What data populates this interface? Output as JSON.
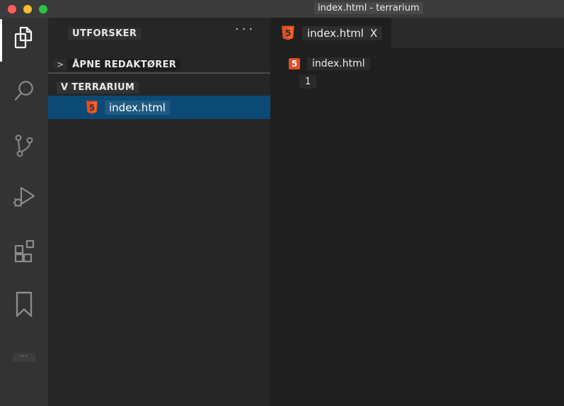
{
  "window": {
    "title": "index.html - terrarium"
  },
  "titlebar": {
    "traffic_lights": [
      {
        "name": "close",
        "color": "#ff5f57"
      },
      {
        "name": "minimize",
        "color": "#febc2e"
      },
      {
        "name": "zoom",
        "color": "#28c840"
      }
    ]
  },
  "activity_bar": {
    "items": [
      {
        "id": "explorer",
        "icon": "files-icon",
        "active": true
      },
      {
        "id": "search",
        "icon": "search-icon",
        "active": false
      },
      {
        "id": "source-control",
        "icon": "source-control-icon",
        "active": false
      },
      {
        "id": "run-debug",
        "icon": "run-debug-icon",
        "active": false
      },
      {
        "id": "extensions",
        "icon": "extensions-icon",
        "active": false
      },
      {
        "id": "bookmarks",
        "icon": "bookmark-icon",
        "active": false
      }
    ],
    "more_label": "..."
  },
  "sidebar": {
    "title": "UTFORSKER",
    "actions_label": "···",
    "sections": [
      {
        "chevron": ">",
        "label": "ÅPNE REDAKTØRER",
        "collapsed": true
      },
      {
        "chevron": "V",
        "label": "TERRARIUM",
        "collapsed": false
      }
    ],
    "files": [
      {
        "name": "index.html",
        "icon": "html5",
        "selected": true
      }
    ]
  },
  "editor": {
    "tab": {
      "label": "index.html",
      "close_label": "X",
      "active": true,
      "icon": "html5"
    },
    "breadcrumb": {
      "file": "index.html",
      "icon": "html5"
    },
    "lines": [
      {
        "number": "1",
        "content": ""
      }
    ]
  },
  "icons": {
    "html5_text": "5"
  },
  "colors": {
    "selection_blue": "#0b4a74",
    "html5_orange": "#e44d26",
    "html5_orange_light": "#f16529",
    "titlebar_bg": "#3b3b3b",
    "activity_bar_bg": "#333333",
    "sidebar_bg": "#262626",
    "editor_bg": "#1f1f1f",
    "tabbar_bg": "#2a2a2b",
    "active_icon": "#ffffff",
    "inactive_icon": "#8b8b8b"
  }
}
